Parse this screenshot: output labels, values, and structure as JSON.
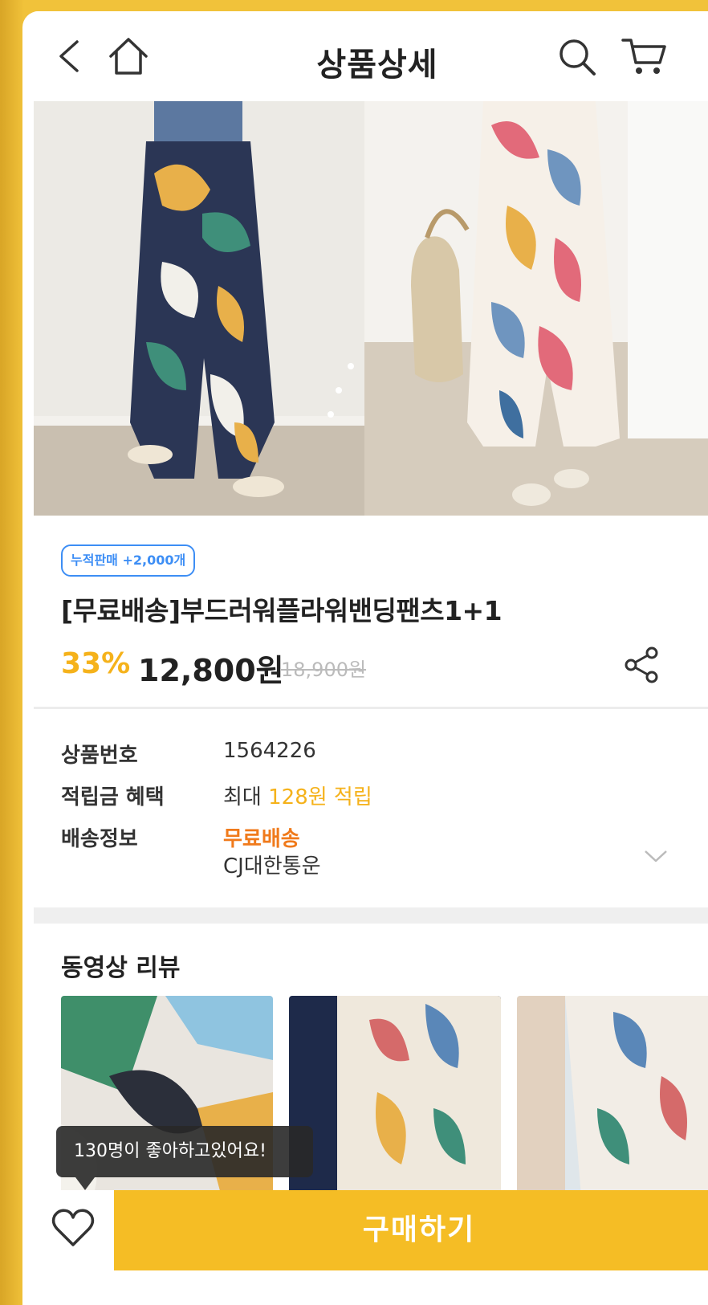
{
  "header": {
    "title": "상품상세",
    "back_icon": "chevron-left-icon",
    "home_icon": "home-icon",
    "search_icon": "search-icon",
    "cart_icon": "cart-icon"
  },
  "product": {
    "badge": "누적판매 +2,000개",
    "title": "[무료배송]부드러워플라워밴딩팬츠1+1",
    "discount": "33%",
    "price": "12,800원",
    "original_price": "18,900원"
  },
  "specs": {
    "number_label": "상품번호",
    "number_value": "1564226",
    "points_label": "적립금 혜택",
    "points_prefix": "최대",
    "points_value": "128원 적립",
    "shipping_label": "배송정보",
    "shipping_free": "무료배송",
    "shipping_carrier": "CJ대한통운"
  },
  "reviews": {
    "title": "동영상 리뷰",
    "tooltip": "130명이 좋아하고있어요!"
  },
  "bottom": {
    "buy_label": "구매하기"
  },
  "colors": {
    "accent": "#f5bd25",
    "badge_blue": "#3d8ef5",
    "free_shipping": "#f07a1b"
  }
}
